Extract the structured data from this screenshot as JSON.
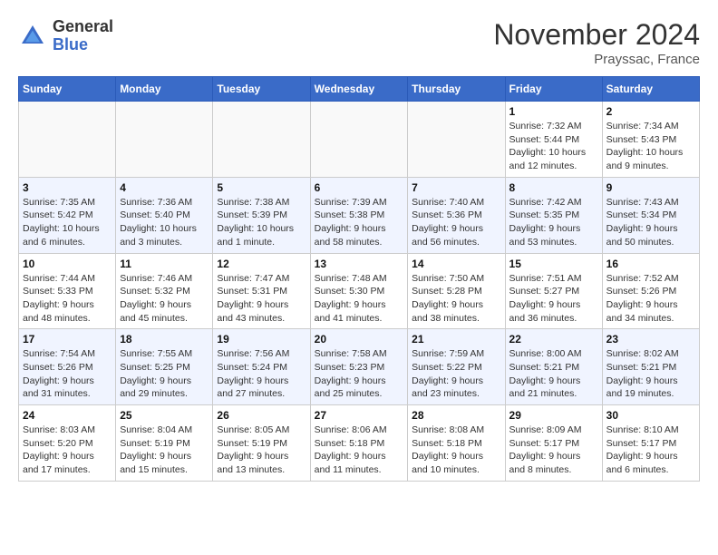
{
  "header": {
    "logo_general": "General",
    "logo_blue": "Blue",
    "month_title": "November 2024",
    "location": "Prayssac, France"
  },
  "days_of_week": [
    "Sunday",
    "Monday",
    "Tuesday",
    "Wednesday",
    "Thursday",
    "Friday",
    "Saturday"
  ],
  "weeks": [
    {
      "row": 1,
      "days": [
        {
          "num": "",
          "detail": ""
        },
        {
          "num": "",
          "detail": ""
        },
        {
          "num": "",
          "detail": ""
        },
        {
          "num": "",
          "detail": ""
        },
        {
          "num": "",
          "detail": ""
        },
        {
          "num": "1",
          "detail": "Sunrise: 7:32 AM\nSunset: 5:44 PM\nDaylight: 10 hours and 12 minutes."
        },
        {
          "num": "2",
          "detail": "Sunrise: 7:34 AM\nSunset: 5:43 PM\nDaylight: 10 hours and 9 minutes."
        }
      ]
    },
    {
      "row": 2,
      "days": [
        {
          "num": "3",
          "detail": "Sunrise: 7:35 AM\nSunset: 5:42 PM\nDaylight: 10 hours and 6 minutes."
        },
        {
          "num": "4",
          "detail": "Sunrise: 7:36 AM\nSunset: 5:40 PM\nDaylight: 10 hours and 3 minutes."
        },
        {
          "num": "5",
          "detail": "Sunrise: 7:38 AM\nSunset: 5:39 PM\nDaylight: 10 hours and 1 minute."
        },
        {
          "num": "6",
          "detail": "Sunrise: 7:39 AM\nSunset: 5:38 PM\nDaylight: 9 hours and 58 minutes."
        },
        {
          "num": "7",
          "detail": "Sunrise: 7:40 AM\nSunset: 5:36 PM\nDaylight: 9 hours and 56 minutes."
        },
        {
          "num": "8",
          "detail": "Sunrise: 7:42 AM\nSunset: 5:35 PM\nDaylight: 9 hours and 53 minutes."
        },
        {
          "num": "9",
          "detail": "Sunrise: 7:43 AM\nSunset: 5:34 PM\nDaylight: 9 hours and 50 minutes."
        }
      ]
    },
    {
      "row": 3,
      "days": [
        {
          "num": "10",
          "detail": "Sunrise: 7:44 AM\nSunset: 5:33 PM\nDaylight: 9 hours and 48 minutes."
        },
        {
          "num": "11",
          "detail": "Sunrise: 7:46 AM\nSunset: 5:32 PM\nDaylight: 9 hours and 45 minutes."
        },
        {
          "num": "12",
          "detail": "Sunrise: 7:47 AM\nSunset: 5:31 PM\nDaylight: 9 hours and 43 minutes."
        },
        {
          "num": "13",
          "detail": "Sunrise: 7:48 AM\nSunset: 5:30 PM\nDaylight: 9 hours and 41 minutes."
        },
        {
          "num": "14",
          "detail": "Sunrise: 7:50 AM\nSunset: 5:28 PM\nDaylight: 9 hours and 38 minutes."
        },
        {
          "num": "15",
          "detail": "Sunrise: 7:51 AM\nSunset: 5:27 PM\nDaylight: 9 hours and 36 minutes."
        },
        {
          "num": "16",
          "detail": "Sunrise: 7:52 AM\nSunset: 5:26 PM\nDaylight: 9 hours and 34 minutes."
        }
      ]
    },
    {
      "row": 4,
      "days": [
        {
          "num": "17",
          "detail": "Sunrise: 7:54 AM\nSunset: 5:26 PM\nDaylight: 9 hours and 31 minutes."
        },
        {
          "num": "18",
          "detail": "Sunrise: 7:55 AM\nSunset: 5:25 PM\nDaylight: 9 hours and 29 minutes."
        },
        {
          "num": "19",
          "detail": "Sunrise: 7:56 AM\nSunset: 5:24 PM\nDaylight: 9 hours and 27 minutes."
        },
        {
          "num": "20",
          "detail": "Sunrise: 7:58 AM\nSunset: 5:23 PM\nDaylight: 9 hours and 25 minutes."
        },
        {
          "num": "21",
          "detail": "Sunrise: 7:59 AM\nSunset: 5:22 PM\nDaylight: 9 hours and 23 minutes."
        },
        {
          "num": "22",
          "detail": "Sunrise: 8:00 AM\nSunset: 5:21 PM\nDaylight: 9 hours and 21 minutes."
        },
        {
          "num": "23",
          "detail": "Sunrise: 8:02 AM\nSunset: 5:21 PM\nDaylight: 9 hours and 19 minutes."
        }
      ]
    },
    {
      "row": 5,
      "days": [
        {
          "num": "24",
          "detail": "Sunrise: 8:03 AM\nSunset: 5:20 PM\nDaylight: 9 hours and 17 minutes."
        },
        {
          "num": "25",
          "detail": "Sunrise: 8:04 AM\nSunset: 5:19 PM\nDaylight: 9 hours and 15 minutes."
        },
        {
          "num": "26",
          "detail": "Sunrise: 8:05 AM\nSunset: 5:19 PM\nDaylight: 9 hours and 13 minutes."
        },
        {
          "num": "27",
          "detail": "Sunrise: 8:06 AM\nSunset: 5:18 PM\nDaylight: 9 hours and 11 minutes."
        },
        {
          "num": "28",
          "detail": "Sunrise: 8:08 AM\nSunset: 5:18 PM\nDaylight: 9 hours and 10 minutes."
        },
        {
          "num": "29",
          "detail": "Sunrise: 8:09 AM\nSunset: 5:17 PM\nDaylight: 9 hours and 8 minutes."
        },
        {
          "num": "30",
          "detail": "Sunrise: 8:10 AM\nSunset: 5:17 PM\nDaylight: 9 hours and 6 minutes."
        }
      ]
    }
  ]
}
